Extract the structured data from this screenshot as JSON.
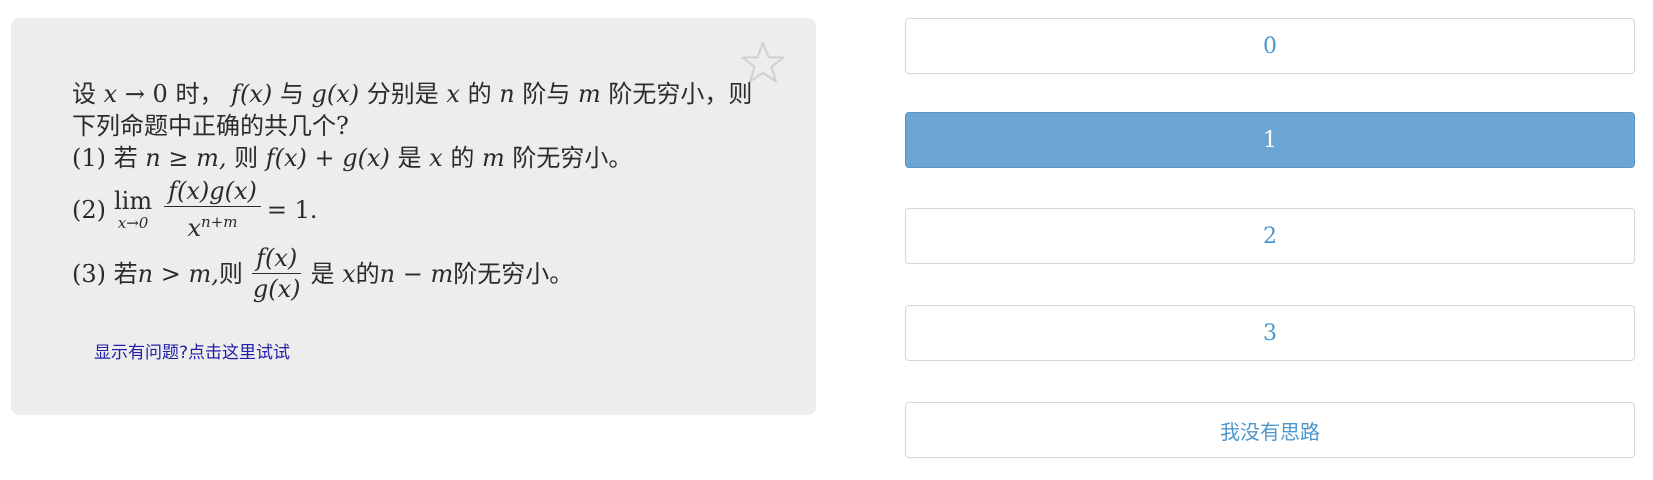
{
  "question": {
    "intro_1": "设",
    "intro_x": "x",
    "intro_arrow": " → 0 时，",
    "intro_fx": "f(x)",
    "intro_and": " 与 ",
    "intro_gx": "g(x)",
    "intro_resp": " 分别是 ",
    "intro_x2": "x",
    "intro_de": " 的 ",
    "intro_n": "n",
    "intro_order_and": " 阶与 ",
    "intro_m": "m",
    "intro_tail": " 阶无穷小，则下列命题中正确的共几个?",
    "item1_prefix": "(1) 若 ",
    "item1_cond": "n ≥ m,",
    "item1_then": " 则 ",
    "item1_expr": "f(x) + g(x)",
    "item1_is": " 是 ",
    "item1_x": "x",
    "item1_de": " 的 ",
    "item1_m": "m",
    "item1_tail": " 阶无穷小。",
    "item2_prefix": "(2)",
    "item2_lim": "lim",
    "item2_lim_sub": "x→0",
    "item2_num": "f(x)g(x)",
    "item2_den_base": "x",
    "item2_den_exp": "n+m",
    "item2_tail": " = 1.",
    "item3_prefix": "(3) 若 ",
    "item3_cond": "n > m,",
    "item3_then": " 则 ",
    "item3_num": "f(x)",
    "item3_den": "g(x)",
    "item3_is": " 是 ",
    "item3_x": "x",
    "item3_de": " 的 ",
    "item3_order": "n − m",
    "item3_tail": " 阶无穷小。"
  },
  "help_link": "显示有问题?点击这里试试",
  "favorite_icon": "star-outline-icon",
  "options": [
    {
      "label": "0",
      "selected": false
    },
    {
      "label": "1",
      "selected": true
    },
    {
      "label": "2",
      "selected": false
    },
    {
      "label": "3",
      "selected": false
    },
    {
      "label": "我没有思路",
      "selected": false
    }
  ],
  "colors": {
    "card_bg": "#ededed",
    "option_text": "#4d97cc",
    "selected_bg": "#6ba5d4",
    "link": "#2121a8"
  }
}
